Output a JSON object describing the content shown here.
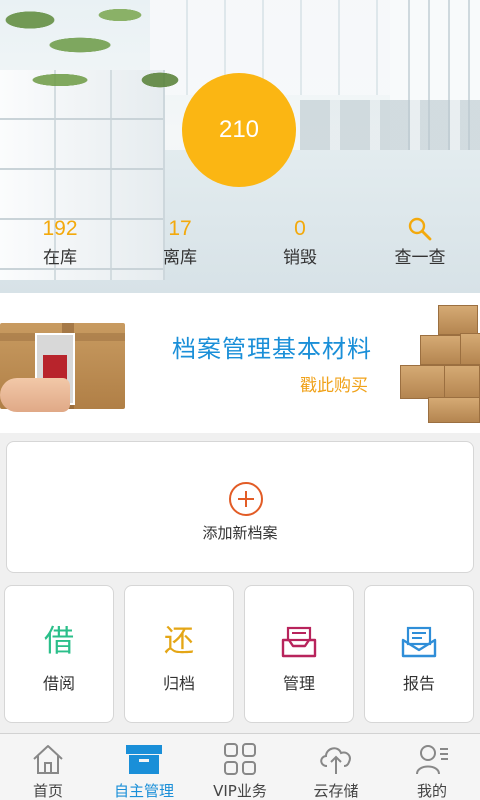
{
  "hero": {
    "score": "210",
    "stats": [
      {
        "value": "192",
        "label": "在库"
      },
      {
        "value": "17",
        "label": "离库"
      },
      {
        "value": "0",
        "label": "销毁"
      }
    ],
    "search": {
      "label": "查一查",
      "icon": "search-icon"
    }
  },
  "banner": {
    "title": "档案管理基本材料",
    "subtitle": "戳此购买"
  },
  "add_card": {
    "label": "添加新档案",
    "icon": "plus-circle-icon"
  },
  "functions": [
    {
      "glyph": "借",
      "label": "借阅",
      "color": "#2bbf8a"
    },
    {
      "glyph": "还",
      "label": "归档",
      "color": "#e4a616"
    },
    {
      "icon": "inbox-icon",
      "label": "管理",
      "color": "#b8245c"
    },
    {
      "icon": "report-icon",
      "label": "报告",
      "color": "#2f8ed8"
    }
  ],
  "tabs": [
    {
      "label": "首页",
      "icon": "home-icon",
      "active": false
    },
    {
      "label": "自主管理",
      "icon": "archive-box-icon",
      "active": true
    },
    {
      "label": "VIP业务",
      "icon": "grid-icon",
      "active": false
    },
    {
      "label": "云存储",
      "icon": "cloud-upload-icon",
      "active": false
    },
    {
      "label": "我的",
      "icon": "user-icon",
      "active": false
    }
  ],
  "colors": {
    "accent": "#fbb613",
    "stat_number": "#f3a90c",
    "primary_blue": "#1a8fd8",
    "add_orange": "#e25c26"
  }
}
